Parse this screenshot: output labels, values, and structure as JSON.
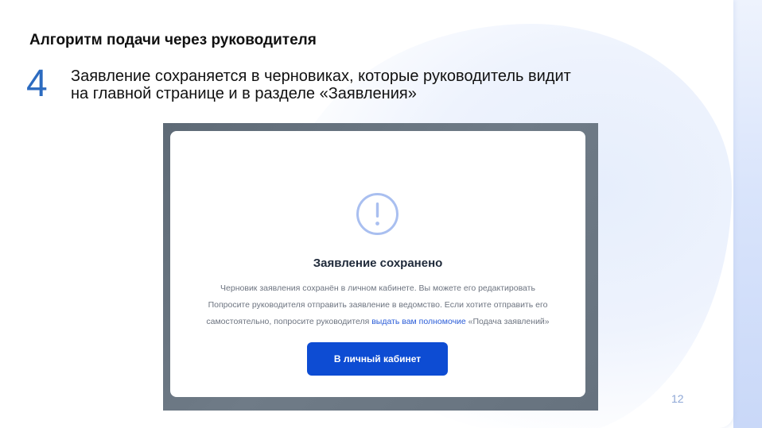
{
  "slide": {
    "title": "Алгоритм подачи через руководителя",
    "step_number": "4",
    "step_text": "Заявление сохраняется в черновиках, которые руководитель видит на главной странице и в разделе «Заявления»",
    "page_number": "12"
  },
  "modal": {
    "icon": "exclamation-circle-icon",
    "title": "Заявление сохранено",
    "text_line1": "Черновик заявления сохранён в личном кабинете. Вы можете его редактировать",
    "text_line2": "Попросите руководителя отправить заявление в ведомство. Если хотите отправить его",
    "text_line3_start": "самостоятельно, попросите руководителя ",
    "text_line3_link": "выдать вам полномочие",
    "text_line3_end": " «Подача заявлений»",
    "button_label": "В личный кабинет"
  },
  "colors": {
    "accent": "#2c6bc0",
    "button": "#0d4cd3",
    "link": "#2a5cd8",
    "page_number": "#8ea7d6"
  }
}
